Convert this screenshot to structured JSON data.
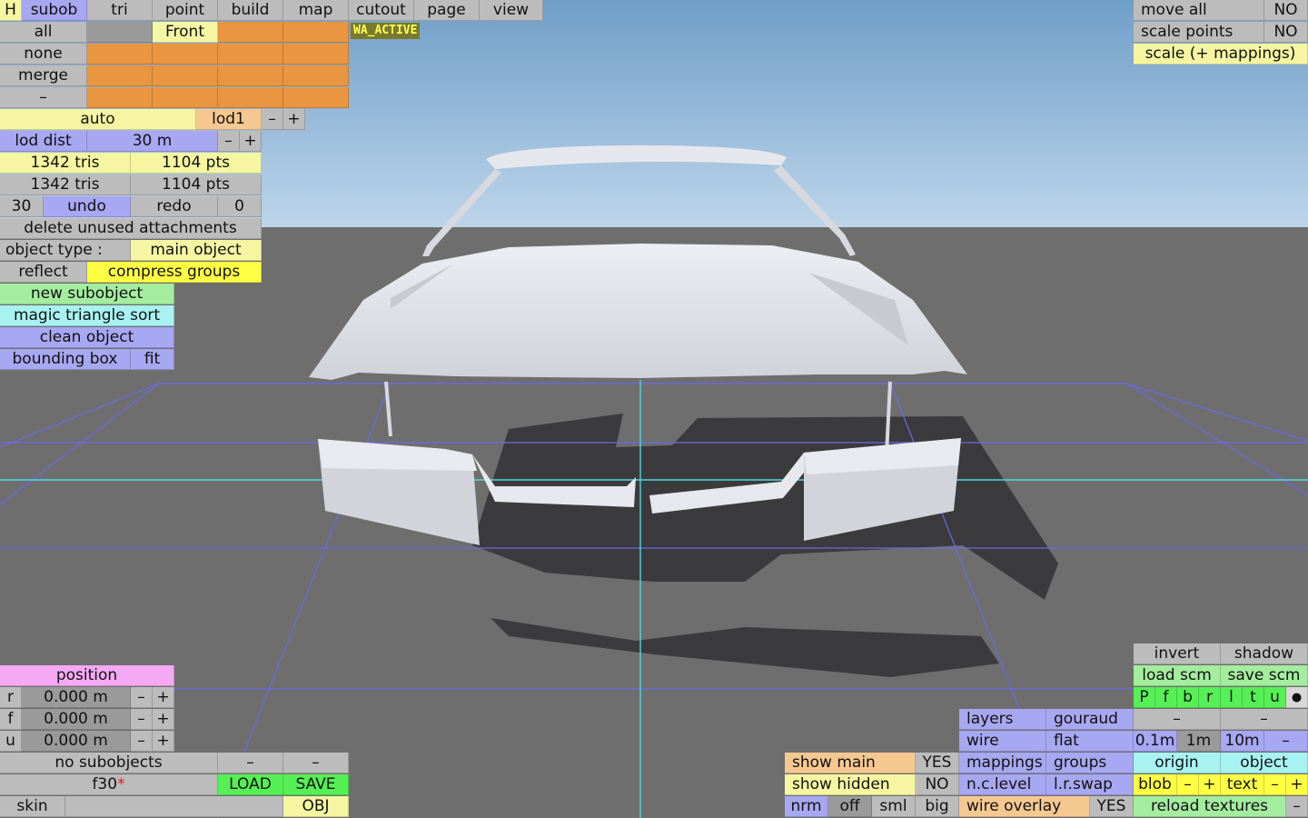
{
  "app": {
    "wa_active": "WA_ACTIVE"
  },
  "menu": {
    "h": "H",
    "tabs": [
      "subob",
      "tri",
      "point",
      "build",
      "map",
      "cutout",
      "page",
      "view"
    ]
  },
  "select": {
    "all": "all",
    "none": "none",
    "merge": "merge",
    "minus": "–",
    "view_front": "Front"
  },
  "lod": {
    "auto": "auto",
    "name": "lod1",
    "dist_label": "lod dist",
    "dist_value": "30 m",
    "minus": "–",
    "plus": "+"
  },
  "stats": {
    "tris1": "1342 tris",
    "pts1": "1104 pts",
    "tris2": "1342 tris",
    "pts2": "1104 pts"
  },
  "history": {
    "undo_count": "30",
    "undo": "undo",
    "redo": "redo",
    "redo_count": "0"
  },
  "object": {
    "delete_unused": "delete unused attachments",
    "type_label": "object type :",
    "type_value": "main object",
    "reflect": "reflect",
    "compress": "compress groups",
    "new_subobject": "new subobject",
    "magic_sort": "magic triangle sort",
    "clean": "clean object",
    "bounding_box": "bounding box",
    "fit": "fit"
  },
  "top_right": {
    "move_all": "move all",
    "move_all_value": "NO",
    "scale_points": "scale points",
    "scale_points_value": "NO",
    "scale_mappings": "scale (+ mappings)"
  },
  "position": {
    "title": "position",
    "rows": [
      {
        "axis": "r",
        "value": "0.000 m"
      },
      {
        "axis": "f",
        "value": "0.000 m"
      },
      {
        "axis": "u",
        "value": "0.000 m"
      }
    ],
    "minus": "–",
    "plus": "+"
  },
  "bottom_left": {
    "no_subobjects": "no subobjects",
    "dash": "–",
    "file_name": "f30",
    "modified_mark": "*",
    "load": "LOAD",
    "save": "SAVE",
    "skin": "skin",
    "obj": "OBJ"
  },
  "display": {
    "show_main": "show main",
    "show_main_value": "YES",
    "show_hidden": "show hidden",
    "show_hidden_value": "NO",
    "nrm": "nrm",
    "off": "off",
    "sml": "sml",
    "big": "big",
    "layers": "layers",
    "gouraud": "gouraud",
    "wire": "wire",
    "flat": "flat",
    "mappings": "mappings",
    "groups": "groups",
    "nc_level": "n.c.level",
    "lr_swap": "l.r.swap",
    "wire_overlay": "wire overlay",
    "wire_overlay_value": "YES"
  },
  "bottom_right": {
    "invert": "invert",
    "shadow": "shadow",
    "load_scm": "load scm",
    "save_scm": "save scm",
    "views": [
      "P",
      "f",
      "b",
      "r",
      "l",
      "t",
      "u"
    ],
    "dot": "●",
    "dash": "–",
    "step_01": "0.1m",
    "step_1": "1m",
    "step_10": "10m",
    "origin": "origin",
    "object": "object",
    "blob": "blob",
    "text": "text",
    "minus": "–",
    "plus": "+",
    "reload_textures": "reload textures"
  },
  "colors": {
    "sky_top": "#6f9ec8",
    "sky_bottom": "#bdd5ea",
    "ground": "#6e6e6e",
    "grid": "#6a6ae8",
    "axis": "#4fd8e0",
    "model": "#e3e4ea",
    "shadow": "#3b3a3c"
  }
}
